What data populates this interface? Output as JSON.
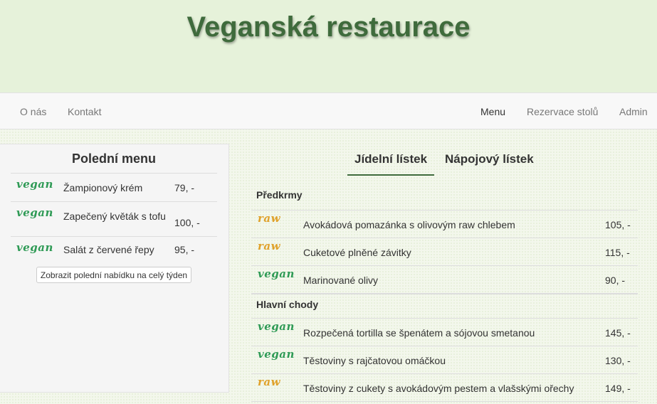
{
  "site": {
    "title": "Veganská restaurace"
  },
  "nav": {
    "left": [
      "O nás",
      "Kontakt"
    ],
    "right": [
      "Menu",
      "Rezervace stolů",
      "Admin"
    ],
    "active": "Menu"
  },
  "lunch": {
    "title": "Polední menu",
    "items": [
      {
        "badge": "vegan",
        "name": "Žampionový krém",
        "price": "79, -"
      },
      {
        "badge": "vegan",
        "name": "Zapečený květák s tofu",
        "price": "100, -"
      },
      {
        "badge": "vegan",
        "name": "Salát z červené řepy",
        "price": "95, -"
      }
    ],
    "week_button": "Zobrazit polední nabídku na celý týden"
  },
  "menu": {
    "tabs": [
      "Jídelní lístek",
      "Nápojový lístek"
    ],
    "active_tab": "Jídelní lístek",
    "sections": [
      {
        "title": "Předkrmy",
        "items": [
          {
            "badge": "raw",
            "name": "Avokádová pomazánka s olivovým raw chlebem",
            "price": "105, -"
          },
          {
            "badge": "raw",
            "name": "Cuketové plněné závitky",
            "price": "115, -"
          },
          {
            "badge": "vegan",
            "name": "Marinované olivy",
            "price": "90, -"
          }
        ]
      },
      {
        "title": "Hlavní chody",
        "items": [
          {
            "badge": "vegan",
            "name": "Rozpečená tortilla se špenátem a sójovou smetanou",
            "price": "145, -"
          },
          {
            "badge": "vegan",
            "name": "Těstoviny s rajčatovou omáčkou",
            "price": "130, -"
          },
          {
            "badge": "raw",
            "name": "Těstoviny z cukety s avokádovým pestem a vlašskými ořechy",
            "price": "149, -"
          }
        ]
      }
    ]
  },
  "colors": {
    "vegan": "#2e9a55",
    "raw": "#e0a12a",
    "brand": "#3f6b3c"
  }
}
